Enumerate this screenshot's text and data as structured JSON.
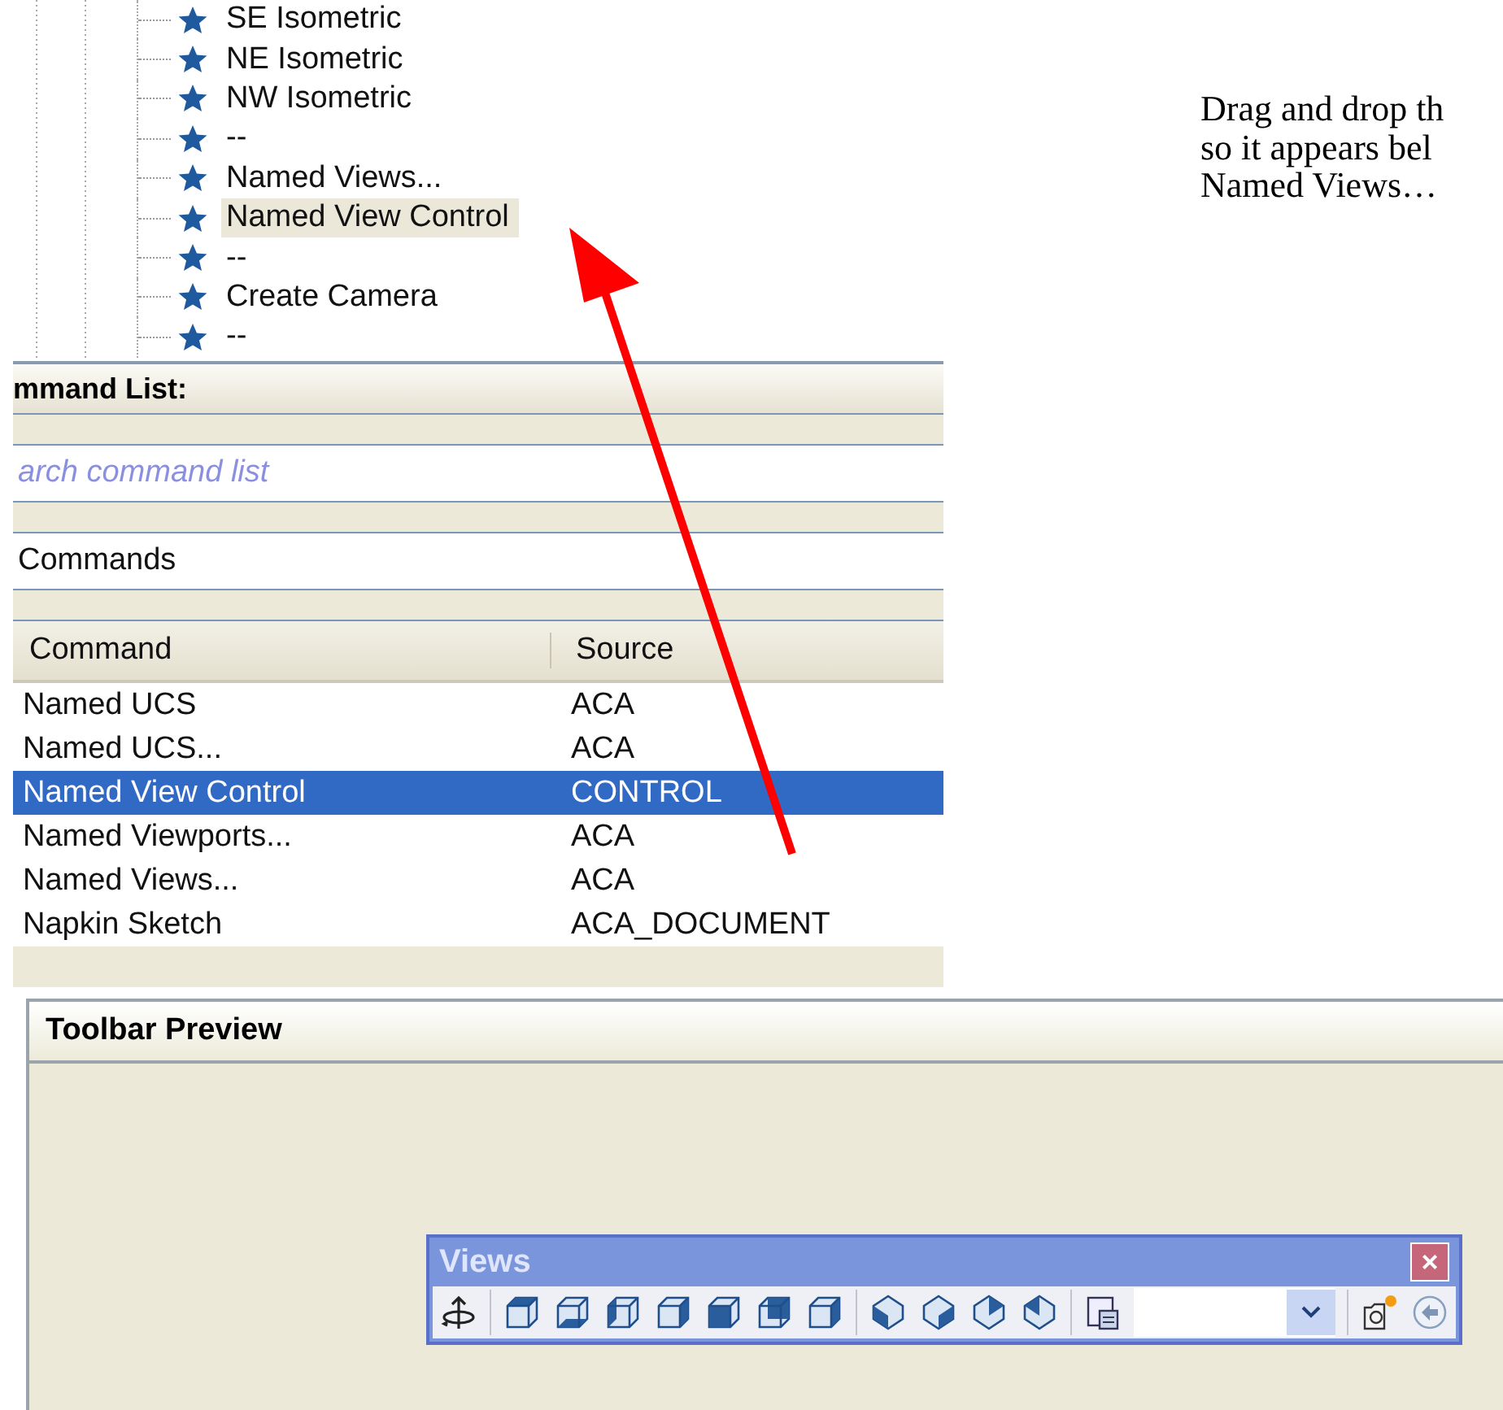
{
  "tree": {
    "items": [
      {
        "label": "SE Isometric",
        "selected": false
      },
      {
        "label": "NE Isometric",
        "selected": false
      },
      {
        "label": "NW Isometric",
        "selected": false
      },
      {
        "label": "--",
        "selected": false
      },
      {
        "label": "Named Views...",
        "selected": false
      },
      {
        "label": "Named View Control",
        "selected": true
      },
      {
        "label": "--",
        "selected": false
      },
      {
        "label": "Create Camera",
        "selected": false
      },
      {
        "label": "--",
        "selected": false
      }
    ]
  },
  "command_list": {
    "title": "mmand List:",
    "search": {
      "placeholder": "arch command list"
    },
    "filter": {
      "value": "Commands"
    },
    "columns": [
      "Command",
      "Source"
    ],
    "rows": [
      {
        "command": "Named UCS",
        "source": "ACA",
        "selected": false
      },
      {
        "command": "Named UCS...",
        "source": "ACA",
        "selected": false
      },
      {
        "command": "Named View Control",
        "source": "CONTROL",
        "selected": true
      },
      {
        "command": "Named Viewports...",
        "source": "ACA",
        "selected": false
      },
      {
        "command": "Named Views...",
        "source": "ACA",
        "selected": false
      },
      {
        "command": "Napkin Sketch",
        "source": "ACA_DOCUMENT",
        "selected": false
      }
    ]
  },
  "note": {
    "lines": [
      "Drag and drop th",
      "so it appears bel",
      "Named Views…"
    ]
  },
  "toolbar_preview": {
    "title": "Toolbar Preview",
    "toolbar": {
      "title": "Views",
      "close": "×"
    }
  }
}
